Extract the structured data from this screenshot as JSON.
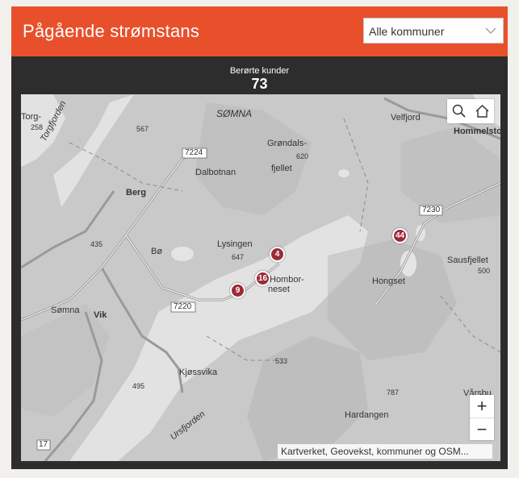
{
  "header": {
    "title": "Pågående strømstans"
  },
  "filter": {
    "selected": "Alle kommuner"
  },
  "stats": {
    "label": "Berørte kunder",
    "value": "73"
  },
  "map": {
    "places": [
      {
        "id": "torg",
        "name": "Torg-"
      },
      {
        "id": "torg-h",
        "name": "258"
      },
      {
        "id": "somna-n",
        "name": "SØMNA"
      },
      {
        "id": "velfjord",
        "name": "Velfjord"
      },
      {
        "id": "hommelsto",
        "name": "Hommelsto"
      },
      {
        "id": "grondals",
        "name": "Grøndals-"
      },
      {
        "id": "fjellet",
        "name": "fjellet"
      },
      {
        "id": "h620",
        "name": "620"
      },
      {
        "id": "dalbotnan",
        "name": "Dalbotnan"
      },
      {
        "id": "berg",
        "name": "Berg"
      },
      {
        "id": "h567",
        "name": "567"
      },
      {
        "id": "lysingen",
        "name": "Lysingen"
      },
      {
        "id": "h647",
        "name": "647"
      },
      {
        "id": "bo",
        "name": "Bø"
      },
      {
        "id": "h435",
        "name": "435"
      },
      {
        "id": "homborneset1",
        "name": "Hombor-"
      },
      {
        "id": "homborneset2",
        "name": "neset"
      },
      {
        "id": "hongset",
        "name": "Hongset"
      },
      {
        "id": "sausfjellet",
        "name": "Sausfjellet"
      },
      {
        "id": "h500",
        "name": "500"
      },
      {
        "id": "somna",
        "name": "Sømna"
      },
      {
        "id": "vik",
        "name": "Vik"
      },
      {
        "id": "kjossvika",
        "name": "Kjøssvika"
      },
      {
        "id": "h533",
        "name": "533"
      },
      {
        "id": "h495",
        "name": "495"
      },
      {
        "id": "h787",
        "name": "787"
      },
      {
        "id": "hardangen",
        "name": "Hardangen"
      },
      {
        "id": "varsbu",
        "name": "Vårsbu"
      },
      {
        "id": "torgfjorden",
        "name": "Torgfjorden"
      },
      {
        "id": "ursfjorden",
        "name": "Ursfjorden"
      }
    ],
    "roads": {
      "r7224": "7224",
      "r7220": "7220",
      "r7230": "7230",
      "r17": "17"
    },
    "outages": [
      {
        "id": "o4",
        "count": "4"
      },
      {
        "id": "o16",
        "count": "16"
      },
      {
        "id": "o9",
        "count": "9"
      },
      {
        "id": "o44",
        "count": "44"
      }
    ],
    "attribution": "Kartverket, Geovekst, kommuner og OSM...",
    "zoom_in": "+",
    "zoom_out": "−"
  },
  "colors": {
    "accent": "#e8502b",
    "panel": "#2d2d2d",
    "marker": "#9b2b36"
  }
}
